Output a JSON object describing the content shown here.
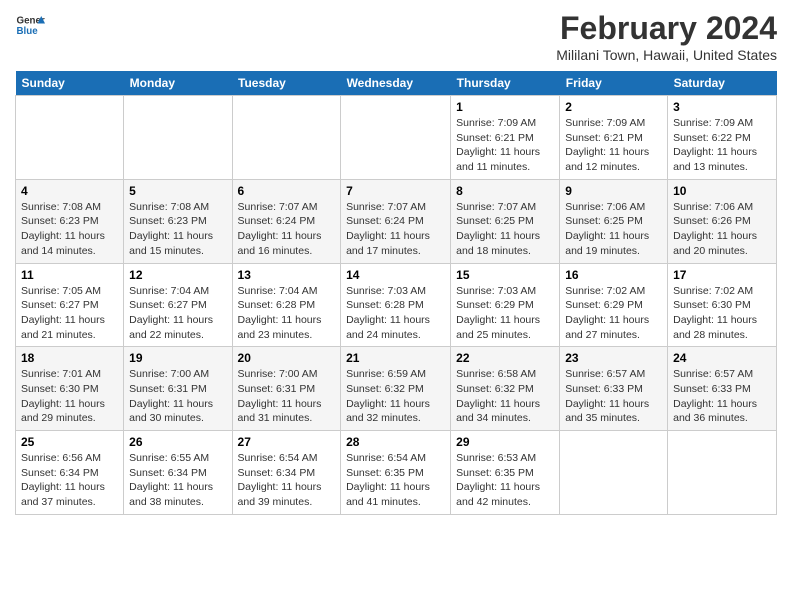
{
  "header": {
    "logo_line1": "General",
    "logo_line2": "Blue",
    "title": "February 2024",
    "subtitle": "Mililani Town, Hawaii, United States"
  },
  "days_of_week": [
    "Sunday",
    "Monday",
    "Tuesday",
    "Wednesday",
    "Thursday",
    "Friday",
    "Saturday"
  ],
  "weeks": [
    [
      {
        "day": "",
        "info": ""
      },
      {
        "day": "",
        "info": ""
      },
      {
        "day": "",
        "info": ""
      },
      {
        "day": "",
        "info": ""
      },
      {
        "day": "1",
        "info": "Sunrise: 7:09 AM\nSunset: 6:21 PM\nDaylight: 11 hours and 11 minutes."
      },
      {
        "day": "2",
        "info": "Sunrise: 7:09 AM\nSunset: 6:21 PM\nDaylight: 11 hours and 12 minutes."
      },
      {
        "day": "3",
        "info": "Sunrise: 7:09 AM\nSunset: 6:22 PM\nDaylight: 11 hours and 13 minutes."
      }
    ],
    [
      {
        "day": "4",
        "info": "Sunrise: 7:08 AM\nSunset: 6:23 PM\nDaylight: 11 hours and 14 minutes."
      },
      {
        "day": "5",
        "info": "Sunrise: 7:08 AM\nSunset: 6:23 PM\nDaylight: 11 hours and 15 minutes."
      },
      {
        "day": "6",
        "info": "Sunrise: 7:07 AM\nSunset: 6:24 PM\nDaylight: 11 hours and 16 minutes."
      },
      {
        "day": "7",
        "info": "Sunrise: 7:07 AM\nSunset: 6:24 PM\nDaylight: 11 hours and 17 minutes."
      },
      {
        "day": "8",
        "info": "Sunrise: 7:07 AM\nSunset: 6:25 PM\nDaylight: 11 hours and 18 minutes."
      },
      {
        "day": "9",
        "info": "Sunrise: 7:06 AM\nSunset: 6:25 PM\nDaylight: 11 hours and 19 minutes."
      },
      {
        "day": "10",
        "info": "Sunrise: 7:06 AM\nSunset: 6:26 PM\nDaylight: 11 hours and 20 minutes."
      }
    ],
    [
      {
        "day": "11",
        "info": "Sunrise: 7:05 AM\nSunset: 6:27 PM\nDaylight: 11 hours and 21 minutes."
      },
      {
        "day": "12",
        "info": "Sunrise: 7:04 AM\nSunset: 6:27 PM\nDaylight: 11 hours and 22 minutes."
      },
      {
        "day": "13",
        "info": "Sunrise: 7:04 AM\nSunset: 6:28 PM\nDaylight: 11 hours and 23 minutes."
      },
      {
        "day": "14",
        "info": "Sunrise: 7:03 AM\nSunset: 6:28 PM\nDaylight: 11 hours and 24 minutes."
      },
      {
        "day": "15",
        "info": "Sunrise: 7:03 AM\nSunset: 6:29 PM\nDaylight: 11 hours and 25 minutes."
      },
      {
        "day": "16",
        "info": "Sunrise: 7:02 AM\nSunset: 6:29 PM\nDaylight: 11 hours and 27 minutes."
      },
      {
        "day": "17",
        "info": "Sunrise: 7:02 AM\nSunset: 6:30 PM\nDaylight: 11 hours and 28 minutes."
      }
    ],
    [
      {
        "day": "18",
        "info": "Sunrise: 7:01 AM\nSunset: 6:30 PM\nDaylight: 11 hours and 29 minutes."
      },
      {
        "day": "19",
        "info": "Sunrise: 7:00 AM\nSunset: 6:31 PM\nDaylight: 11 hours and 30 minutes."
      },
      {
        "day": "20",
        "info": "Sunrise: 7:00 AM\nSunset: 6:31 PM\nDaylight: 11 hours and 31 minutes."
      },
      {
        "day": "21",
        "info": "Sunrise: 6:59 AM\nSunset: 6:32 PM\nDaylight: 11 hours and 32 minutes."
      },
      {
        "day": "22",
        "info": "Sunrise: 6:58 AM\nSunset: 6:32 PM\nDaylight: 11 hours and 34 minutes."
      },
      {
        "day": "23",
        "info": "Sunrise: 6:57 AM\nSunset: 6:33 PM\nDaylight: 11 hours and 35 minutes."
      },
      {
        "day": "24",
        "info": "Sunrise: 6:57 AM\nSunset: 6:33 PM\nDaylight: 11 hours and 36 minutes."
      }
    ],
    [
      {
        "day": "25",
        "info": "Sunrise: 6:56 AM\nSunset: 6:34 PM\nDaylight: 11 hours and 37 minutes."
      },
      {
        "day": "26",
        "info": "Sunrise: 6:55 AM\nSunset: 6:34 PM\nDaylight: 11 hours and 38 minutes."
      },
      {
        "day": "27",
        "info": "Sunrise: 6:54 AM\nSunset: 6:34 PM\nDaylight: 11 hours and 39 minutes."
      },
      {
        "day": "28",
        "info": "Sunrise: 6:54 AM\nSunset: 6:35 PM\nDaylight: 11 hours and 41 minutes."
      },
      {
        "day": "29",
        "info": "Sunrise: 6:53 AM\nSunset: 6:35 PM\nDaylight: 11 hours and 42 minutes."
      },
      {
        "day": "",
        "info": ""
      },
      {
        "day": "",
        "info": ""
      }
    ]
  ]
}
